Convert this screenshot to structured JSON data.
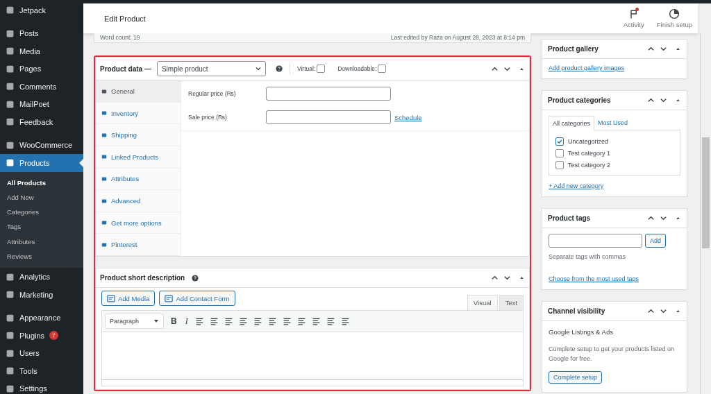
{
  "sidebar": {
    "groups": [
      {
        "items": [
          {
            "label": "Jetpack",
            "selected": false
          }
        ]
      },
      {
        "items": [
          {
            "label": "Posts",
            "selected": false
          },
          {
            "label": "Media",
            "selected": false
          },
          {
            "label": "Pages",
            "selected": false
          },
          {
            "label": "Comments",
            "selected": false
          },
          {
            "label": "MailPoet",
            "selected": false
          },
          {
            "label": "Feedback",
            "selected": false
          }
        ]
      },
      {
        "items": [
          {
            "label": "WooCommerce",
            "selected": false
          },
          {
            "label": "Products",
            "selected": true,
            "children": [
              {
                "label": "All Products",
                "selected": true
              },
              {
                "label": "Add New",
                "selected": false
              },
              {
                "label": "Categories",
                "selected": false
              },
              {
                "label": "Tags",
                "selected": false
              },
              {
                "label": "Attributes",
                "selected": false
              },
              {
                "label": "Reviews",
                "selected": false
              }
            ]
          },
          {
            "label": "Analytics",
            "selected": false
          },
          {
            "label": "Marketing",
            "selected": false
          }
        ]
      },
      {
        "items": [
          {
            "label": "Appearance",
            "selected": false
          },
          {
            "label": "Plugins",
            "selected": false,
            "badge": "7"
          },
          {
            "label": "Users",
            "selected": false
          },
          {
            "label": "Tools",
            "selected": false
          },
          {
            "label": "Settings",
            "selected": false
          }
        ]
      }
    ]
  },
  "header": {
    "title": "Edit Product",
    "actions": [
      {
        "label": "Activity",
        "notification": true
      },
      {
        "label": "Finish setup",
        "notification": false
      }
    ]
  },
  "status": {
    "word_count": "Word count: 19",
    "last_edited": "Last edited by Raza on August 28, 2023 at 8:14 pm"
  },
  "product_data": {
    "title": "Product data —",
    "type": "Simple product",
    "options": [
      {
        "label": "Virtual:",
        "checked": false
      },
      {
        "label": "Downloadable:",
        "checked": false
      }
    ],
    "tabs": [
      {
        "label": "General",
        "selected": true
      },
      {
        "label": "Inventory",
        "selected": false
      },
      {
        "label": "Shipping",
        "selected": false
      },
      {
        "label": "Linked Products",
        "selected": false
      },
      {
        "label": "Attributes",
        "selected": false
      },
      {
        "label": "Advanced",
        "selected": false
      },
      {
        "label": "Get more options",
        "selected": false
      },
      {
        "label": "Pinterest",
        "selected": false
      }
    ],
    "fields": [
      {
        "label": "Regular price (₨)"
      },
      {
        "label": "Sale price (₨)",
        "link": "Schedule"
      }
    ]
  },
  "short_description": {
    "title": "Product short description",
    "media_buttons": [
      "Add Media",
      "Add Contact Form"
    ],
    "editor_tabs": [
      {
        "label": "Visual",
        "selected": true
      },
      {
        "label": "Text",
        "selected": false
      }
    ],
    "format": "Paragraph",
    "bold": "B",
    "italic": "I"
  },
  "gallery": {
    "title": "Product gallery",
    "link": "Add product gallery images"
  },
  "categories": {
    "title": "Product categories",
    "tabs": [
      {
        "label": "All categories",
        "selected": true
      },
      {
        "label": "Most Used",
        "selected": false
      }
    ],
    "items": [
      {
        "label": "Uncategorized",
        "checked": true
      },
      {
        "label": "Test category 1",
        "checked": false
      },
      {
        "label": "Test category 2",
        "checked": false
      }
    ],
    "add_link": "+ Add new category"
  },
  "tags": {
    "title": "Product tags",
    "button": "Add",
    "hint": "Separate tags with commas",
    "link": "Choose from the most used tags"
  },
  "channel": {
    "title": "Channel visibility",
    "subtitle": "Google Listings & Ads",
    "text": "Complete setup to get your products listed on Google for free.",
    "button": "Complete setup"
  }
}
